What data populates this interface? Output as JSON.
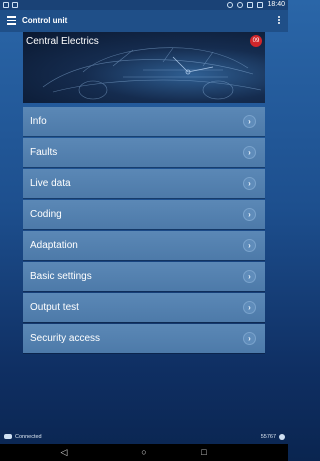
{
  "statusbar": {
    "time": "18:40",
    "left_icons": [
      "notification-icon",
      "image-icon"
    ],
    "right_icons": [
      "bluetooth-icon",
      "alarm-icon",
      "wifi-icon",
      "battery-icon"
    ]
  },
  "appbar": {
    "title": "Control unit",
    "menu_icon": "hamburger-icon",
    "overflow_icon": "more-vert-icon"
  },
  "banner": {
    "title": "Central Electrics",
    "badge": "09",
    "badge_color": "#d0262b"
  },
  "menu": {
    "items": [
      {
        "label": "Info"
      },
      {
        "label": "Faults"
      },
      {
        "label": "Live data"
      },
      {
        "label": "Coding"
      },
      {
        "label": "Adaptation"
      },
      {
        "label": "Basic settings"
      },
      {
        "label": "Output test"
      },
      {
        "label": "Security access"
      }
    ],
    "chevron_glyph": "›"
  },
  "footer": {
    "status": "Connected",
    "code": "55767"
  },
  "navbar": {
    "back": "◁",
    "home": "○",
    "recents": "□"
  },
  "colors": {
    "background_top": "#2a66a8",
    "background_bottom": "#0a2550",
    "item_bg": "#5b88b6",
    "accent": "#d0262b"
  }
}
